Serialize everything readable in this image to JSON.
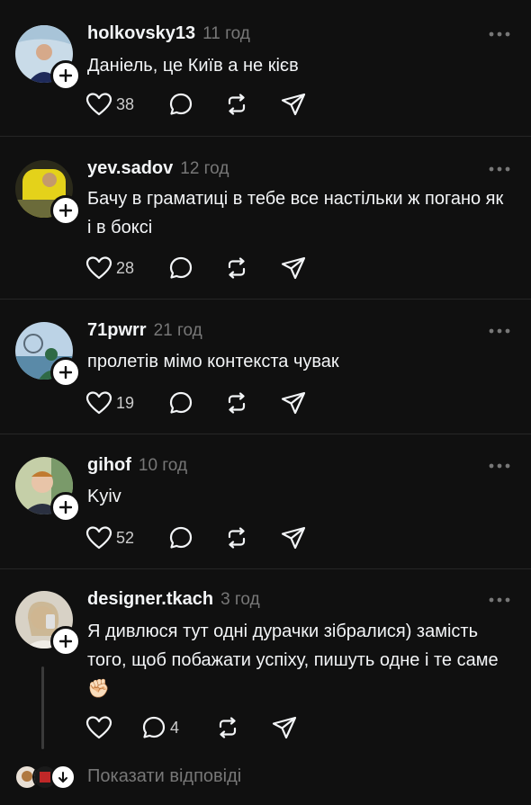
{
  "posts": [
    {
      "username": "holkovsky13",
      "time": "11 год",
      "text": "Даніель, це Київ а не кієв",
      "likes": "38"
    },
    {
      "username": "yev.sadov",
      "time": "12 год",
      "text": "Бачу в граматиці в тебе все настільки ж погано як і в боксі",
      "likes": "28"
    },
    {
      "username": "71pwrr",
      "time": "21 год",
      "text": "пролетів мімо контекста чувак",
      "likes": "19"
    },
    {
      "username": "gihof",
      "time": "10 год",
      "text": "Kyiv",
      "likes": "52"
    },
    {
      "username": "designer.tkach",
      "time": "3 год",
      "text": "Я дивлюся тут одні дурачки зібралися) замість того, щоб побажати успіху, пишуть одне і те саме ✊🏻",
      "likes": "",
      "replies_count": "4"
    }
  ],
  "show_replies_label": "Показати відповіді",
  "icons": [
    "heart-icon",
    "reply-icon",
    "repost-icon",
    "share-icon",
    "more-icon",
    "follow-plus-icon"
  ],
  "colors": {
    "background": "#101010",
    "text": "#f3f5f7",
    "secondary": "#777777",
    "divider": "#262626"
  }
}
